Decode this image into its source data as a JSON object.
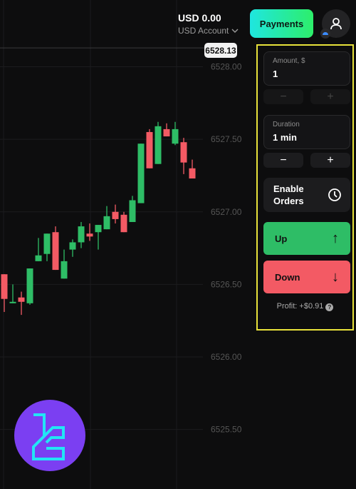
{
  "header": {
    "balance": "USD 0.00",
    "account": "USD Account",
    "payments": "Payments"
  },
  "panel": {
    "amount_label": "Amount, $",
    "amount_value": "1",
    "duration_label": "Duration",
    "duration_value": "1 min",
    "minus": "−",
    "plus": "+",
    "enable_orders_line1": "Enable",
    "enable_orders_line2": "Orders",
    "up": "Up",
    "down": "Down",
    "up_arrow": "↑",
    "down_arrow": "↓",
    "profit": "Profit: +$0.91",
    "help": "?"
  },
  "colors": {
    "up": "#2ebd66",
    "down": "#f35a64",
    "accent": "#e8e23a",
    "logo_bg": "#7b3ff2",
    "logo_fg": "#22e5f5"
  },
  "chart_data": {
    "type": "candlestick",
    "current_price": "6528.13",
    "yticks": [
      "6528.00",
      "6527.50",
      "6527.00",
      "6526.50",
      "6526.00",
      "6525.50"
    ],
    "ylim": [
      6525.09,
      6528.46
    ],
    "candles": [
      [
        6526.57,
        6526.57,
        6526.31,
        6526.4
      ],
      [
        6526.37,
        6526.5,
        6526.37,
        6526.38
      ],
      [
        6526.41,
        6526.45,
        6526.29,
        6526.38
      ],
      [
        6526.37,
        6526.61,
        6526.36,
        6526.61
      ],
      [
        6526.66,
        6526.82,
        6526.66,
        6526.7
      ],
      [
        6526.71,
        6526.85,
        6526.66,
        6526.85
      ],
      [
        6526.86,
        6526.9,
        6526.6,
        6526.6
      ],
      [
        6526.54,
        6526.74,
        6526.54,
        6526.66
      ],
      [
        6526.74,
        6526.81,
        6526.69,
        6526.79
      ],
      [
        6526.79,
        6526.93,
        6526.75,
        6526.9
      ],
      [
        6526.85,
        6526.92,
        6526.8,
        6526.83
      ],
      [
        6526.86,
        6526.91,
        6526.74,
        6526.91
      ],
      [
        6526.88,
        6527.04,
        6526.88,
        6526.97
      ],
      [
        6527.0,
        6527.05,
        6526.92,
        6526.95
      ],
      [
        6526.98,
        6527.0,
        6526.86,
        6526.86
      ],
      [
        6526.93,
        6527.11,
        6526.93,
        6527.08
      ],
      [
        6527.06,
        6527.47,
        6527.06,
        6527.47
      ],
      [
        6527.55,
        6527.57,
        6527.3,
        6527.3
      ],
      [
        6527.33,
        6527.62,
        6527.33,
        6527.59
      ],
      [
        6527.57,
        6527.61,
        6527.52,
        6527.52
      ],
      [
        6527.47,
        6527.62,
        6527.46,
        6527.57
      ],
      [
        6527.48,
        6527.51,
        6527.26,
        6527.34
      ],
      [
        6527.3,
        6527.36,
        6527.23,
        6527.23
      ]
    ]
  }
}
